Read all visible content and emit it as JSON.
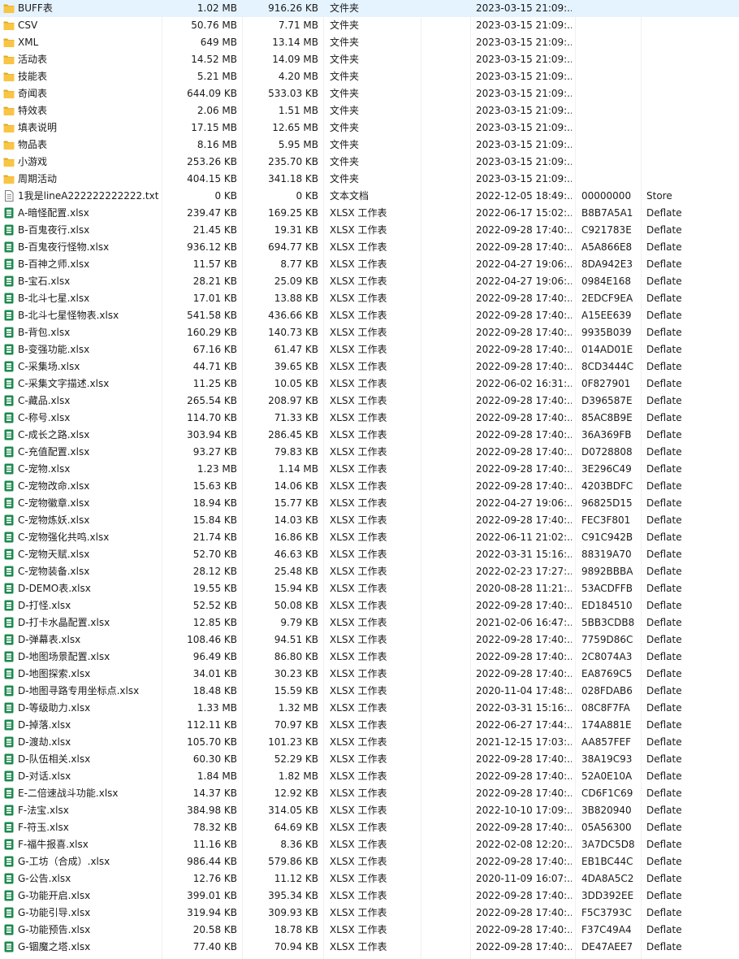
{
  "file_rows": [
    {
      "name": "BUFF表",
      "size": "1.02 MB",
      "packed": "916.26 KB",
      "type": "文件夹",
      "modified": "2023-03-15 21:09:...",
      "crc": "",
      "method": "",
      "icon": "folder-icon"
    },
    {
      "name": "CSV",
      "size": "50.76 MB",
      "packed": "7.71 MB",
      "type": "文件夹",
      "modified": "2023-03-15 21:09:...",
      "crc": "",
      "method": "",
      "icon": "folder-icon"
    },
    {
      "name": "XML",
      "size": "649 MB",
      "packed": "13.14 MB",
      "type": "文件夹",
      "modified": "2023-03-15 21:09:...",
      "crc": "",
      "method": "",
      "icon": "folder-icon"
    },
    {
      "name": "活动表",
      "size": "14.52 MB",
      "packed": "14.09 MB",
      "type": "文件夹",
      "modified": "2023-03-15 21:09:...",
      "crc": "",
      "method": "",
      "icon": "folder-icon"
    },
    {
      "name": "技能表",
      "size": "5.21 MB",
      "packed": "4.20 MB",
      "type": "文件夹",
      "modified": "2023-03-15 21:09:...",
      "crc": "",
      "method": "",
      "icon": "folder-icon"
    },
    {
      "name": "奇闻表",
      "size": "644.09 KB",
      "packed": "533.03 KB",
      "type": "文件夹",
      "modified": "2023-03-15 21:09:...",
      "crc": "",
      "method": "",
      "icon": "folder-icon"
    },
    {
      "name": "特效表",
      "size": "2.06 MB",
      "packed": "1.51 MB",
      "type": "文件夹",
      "modified": "2023-03-15 21:09:...",
      "crc": "",
      "method": "",
      "icon": "folder-icon"
    },
    {
      "name": "填表说明",
      "size": "17.15 MB",
      "packed": "12.65 MB",
      "type": "文件夹",
      "modified": "2023-03-15 21:09:...",
      "crc": "",
      "method": "",
      "icon": "folder-icon"
    },
    {
      "name": "物品表",
      "size": "8.16 MB",
      "packed": "5.95 MB",
      "type": "文件夹",
      "modified": "2023-03-15 21:09:...",
      "crc": "",
      "method": "",
      "icon": "folder-icon"
    },
    {
      "name": "小游戏",
      "size": "253.26 KB",
      "packed": "235.70 KB",
      "type": "文件夹",
      "modified": "2023-03-15 21:09:...",
      "crc": "",
      "method": "",
      "icon": "folder-icon"
    },
    {
      "name": "周期活动",
      "size": "404.15 KB",
      "packed": "341.18 KB",
      "type": "文件夹",
      "modified": "2023-03-15 21:09:...",
      "crc": "",
      "method": "",
      "icon": "folder-icon"
    },
    {
      "name": "1我是lineA222222222222.txt",
      "size": "0 KB",
      "packed": "0 KB",
      "type": "文本文档",
      "modified": "2022-12-05 18:49:...",
      "crc": "00000000",
      "method": "Store",
      "icon": "text-file-icon"
    },
    {
      "name": "A-暗怪配置.xlsx",
      "size": "239.47 KB",
      "packed": "169.25 KB",
      "type": "XLSX 工作表",
      "modified": "2022-06-17 15:02:...",
      "crc": "B8B7A5A1",
      "method": "Deflate",
      "icon": "xlsx-file-icon"
    },
    {
      "name": "B-百鬼夜行.xlsx",
      "size": "21.45 KB",
      "packed": "19.31 KB",
      "type": "XLSX 工作表",
      "modified": "2022-09-28 17:40:...",
      "crc": "C921783E",
      "method": "Deflate",
      "icon": "xlsx-file-icon"
    },
    {
      "name": "B-百鬼夜行怪物.xlsx",
      "size": "936.12 KB",
      "packed": "694.77 KB",
      "type": "XLSX 工作表",
      "modified": "2022-09-28 17:40:...",
      "crc": "A5A866E8",
      "method": "Deflate",
      "icon": "xlsx-file-icon"
    },
    {
      "name": "B-百神之师.xlsx",
      "size": "11.57 KB",
      "packed": "8.77 KB",
      "type": "XLSX 工作表",
      "modified": "2022-04-27 19:06:...",
      "crc": "8DA942E3",
      "method": "Deflate",
      "icon": "xlsx-file-icon"
    },
    {
      "name": "B-宝石.xlsx",
      "size": "28.21 KB",
      "packed": "25.09 KB",
      "type": "XLSX 工作表",
      "modified": "2022-04-27 19:06:...",
      "crc": "0984E168",
      "method": "Deflate",
      "icon": "xlsx-file-icon"
    },
    {
      "name": "B-北斗七星.xlsx",
      "size": "17.01 KB",
      "packed": "13.88 KB",
      "type": "XLSX 工作表",
      "modified": "2022-09-28 17:40:...",
      "crc": "2EDCF9EA",
      "method": "Deflate",
      "icon": "xlsx-file-icon"
    },
    {
      "name": "B-北斗七星怪物表.xlsx",
      "size": "541.58 KB",
      "packed": "436.66 KB",
      "type": "XLSX 工作表",
      "modified": "2022-09-28 17:40:...",
      "crc": "A15EE639",
      "method": "Deflate",
      "icon": "xlsx-file-icon"
    },
    {
      "name": "B-背包.xlsx",
      "size": "160.29 KB",
      "packed": "140.73 KB",
      "type": "XLSX 工作表",
      "modified": "2022-09-28 17:40:...",
      "crc": "9935B039",
      "method": "Deflate",
      "icon": "xlsx-file-icon"
    },
    {
      "name": "B-变强功能.xlsx",
      "size": "67.16 KB",
      "packed": "61.47 KB",
      "type": "XLSX 工作表",
      "modified": "2022-09-28 17:40:...",
      "crc": "014AD01E",
      "method": "Deflate",
      "icon": "xlsx-file-icon"
    },
    {
      "name": "C-采集场.xlsx",
      "size": "44.71 KB",
      "packed": "39.65 KB",
      "type": "XLSX 工作表",
      "modified": "2022-09-28 17:40:...",
      "crc": "8CD3444C",
      "method": "Deflate",
      "icon": "xlsx-file-icon"
    },
    {
      "name": "C-采集文字描述.xlsx",
      "size": "11.25 KB",
      "packed": "10.05 KB",
      "type": "XLSX 工作表",
      "modified": "2022-06-02 16:31:...",
      "crc": "0F827901",
      "method": "Deflate",
      "icon": "xlsx-file-icon"
    },
    {
      "name": "C-藏品.xlsx",
      "size": "265.54 KB",
      "packed": "208.97 KB",
      "type": "XLSX 工作表",
      "modified": "2022-09-28 17:40:...",
      "crc": "D396587E",
      "method": "Deflate",
      "icon": "xlsx-file-icon"
    },
    {
      "name": "C-称号.xlsx",
      "size": "114.70 KB",
      "packed": "71.33 KB",
      "type": "XLSX 工作表",
      "modified": "2022-09-28 17:40:...",
      "crc": "85AC8B9E",
      "method": "Deflate",
      "icon": "xlsx-file-icon"
    },
    {
      "name": "C-成长之路.xlsx",
      "size": "303.94 KB",
      "packed": "286.45 KB",
      "type": "XLSX 工作表",
      "modified": "2022-09-28 17:40:...",
      "crc": "36A369FB",
      "method": "Deflate",
      "icon": "xlsx-file-icon"
    },
    {
      "name": "C-充值配置.xlsx",
      "size": "93.27 KB",
      "packed": "79.83 KB",
      "type": "XLSX 工作表",
      "modified": "2022-09-28 17:40:...",
      "crc": "D0728808",
      "method": "Deflate",
      "icon": "xlsx-file-icon"
    },
    {
      "name": "C-宠物.xlsx",
      "size": "1.23 MB",
      "packed": "1.14 MB",
      "type": "XLSX 工作表",
      "modified": "2022-09-28 17:40:...",
      "crc": "3E296C49",
      "method": "Deflate",
      "icon": "xlsx-file-icon"
    },
    {
      "name": "C-宠物改命.xlsx",
      "size": "15.63 KB",
      "packed": "14.06 KB",
      "type": "XLSX 工作表",
      "modified": "2022-09-28 17:40:...",
      "crc": "4203BDFC",
      "method": "Deflate",
      "icon": "xlsx-file-icon"
    },
    {
      "name": "C-宠物徽章.xlsx",
      "size": "18.94 KB",
      "packed": "15.77 KB",
      "type": "XLSX 工作表",
      "modified": "2022-04-27 19:06:...",
      "crc": "96825D15",
      "method": "Deflate",
      "icon": "xlsx-file-icon"
    },
    {
      "name": "C-宠物炼妖.xlsx",
      "size": "15.84 KB",
      "packed": "14.03 KB",
      "type": "XLSX 工作表",
      "modified": "2022-09-28 17:40:...",
      "crc": "FEC3F801",
      "method": "Deflate",
      "icon": "xlsx-file-icon"
    },
    {
      "name": "C-宠物强化共鸣.xlsx",
      "size": "21.74 KB",
      "packed": "16.86 KB",
      "type": "XLSX 工作表",
      "modified": "2022-06-11 21:02:...",
      "crc": "C91C942B",
      "method": "Deflate",
      "icon": "xlsx-file-icon"
    },
    {
      "name": "C-宠物天赋.xlsx",
      "size": "52.70 KB",
      "packed": "46.63 KB",
      "type": "XLSX 工作表",
      "modified": "2022-03-31 15:16:...",
      "crc": "88319A70",
      "method": "Deflate",
      "icon": "xlsx-file-icon"
    },
    {
      "name": "C-宠物装备.xlsx",
      "size": "28.12 KB",
      "packed": "25.48 KB",
      "type": "XLSX 工作表",
      "modified": "2022-02-23 17:27:...",
      "crc": "9892BBBA",
      "method": "Deflate",
      "icon": "xlsx-file-icon"
    },
    {
      "name": "D-DEMO表.xlsx",
      "size": "19.55 KB",
      "packed": "15.94 KB",
      "type": "XLSX 工作表",
      "modified": "2020-08-28 11:21:...",
      "crc": "53ACDFFB",
      "method": "Deflate",
      "icon": "xlsx-file-icon"
    },
    {
      "name": "D-打怪.xlsx",
      "size": "52.52 KB",
      "packed": "50.08 KB",
      "type": "XLSX 工作表",
      "modified": "2022-09-28 17:40:...",
      "crc": "ED184510",
      "method": "Deflate",
      "icon": "xlsx-file-icon"
    },
    {
      "name": "D-打卡水晶配置.xlsx",
      "size": "12.85 KB",
      "packed": "9.79 KB",
      "type": "XLSX 工作表",
      "modified": "2021-02-06 16:47:...",
      "crc": "5BB3CDB8",
      "method": "Deflate",
      "icon": "xlsx-file-icon"
    },
    {
      "name": "D-弹幕表.xlsx",
      "size": "108.46 KB",
      "packed": "94.51 KB",
      "type": "XLSX 工作表",
      "modified": "2022-09-28 17:40:...",
      "crc": "7759D86C",
      "method": "Deflate",
      "icon": "xlsx-file-icon"
    },
    {
      "name": "D-地图场景配置.xlsx",
      "size": "96.49 KB",
      "packed": "86.80 KB",
      "type": "XLSX 工作表",
      "modified": "2022-09-28 17:40:...",
      "crc": "2C8074A3",
      "method": "Deflate",
      "icon": "xlsx-file-icon"
    },
    {
      "name": "D-地图探索.xlsx",
      "size": "34.01 KB",
      "packed": "30.23 KB",
      "type": "XLSX 工作表",
      "modified": "2022-09-28 17:40:...",
      "crc": "EA8769C5",
      "method": "Deflate",
      "icon": "xlsx-file-icon"
    },
    {
      "name": "D-地图寻路专用坐标点.xlsx",
      "size": "18.48 KB",
      "packed": "15.59 KB",
      "type": "XLSX 工作表",
      "modified": "2020-11-04 17:48:...",
      "crc": "028FDAB6",
      "method": "Deflate",
      "icon": "xlsx-file-icon"
    },
    {
      "name": "D-等级助力.xlsx",
      "size": "1.33 MB",
      "packed": "1.32 MB",
      "type": "XLSX 工作表",
      "modified": "2022-03-31 15:16:...",
      "crc": "08C8F7FA",
      "method": "Deflate",
      "icon": "xlsx-file-icon"
    },
    {
      "name": "D-掉落.xlsx",
      "size": "112.11 KB",
      "packed": "70.97 KB",
      "type": "XLSX 工作表",
      "modified": "2022-06-27 17:44:...",
      "crc": "174A881E",
      "method": "Deflate",
      "icon": "xlsx-file-icon"
    },
    {
      "name": "D-渡劫.xlsx",
      "size": "105.70 KB",
      "packed": "101.23 KB",
      "type": "XLSX 工作表",
      "modified": "2021-12-15 17:03:...",
      "crc": "AA857FEF",
      "method": "Deflate",
      "icon": "xlsx-file-icon"
    },
    {
      "name": "D-队伍相关.xlsx",
      "size": "60.30 KB",
      "packed": "52.29 KB",
      "type": "XLSX 工作表",
      "modified": "2022-09-28 17:40:...",
      "crc": "38A19C93",
      "method": "Deflate",
      "icon": "xlsx-file-icon"
    },
    {
      "name": "D-对话.xlsx",
      "size": "1.84 MB",
      "packed": "1.82 MB",
      "type": "XLSX 工作表",
      "modified": "2022-09-28 17:40:...",
      "crc": "52A0E10A",
      "method": "Deflate",
      "icon": "xlsx-file-icon"
    },
    {
      "name": "E-二倍速战斗功能.xlsx",
      "size": "14.37 KB",
      "packed": "12.92 KB",
      "type": "XLSX 工作表",
      "modified": "2022-09-28 17:40:...",
      "crc": "CD6F1C69",
      "method": "Deflate",
      "icon": "xlsx-file-icon"
    },
    {
      "name": "F-法宝.xlsx",
      "size": "384.98 KB",
      "packed": "314.05 KB",
      "type": "XLSX 工作表",
      "modified": "2022-10-10 17:09:...",
      "crc": "3B820940",
      "method": "Deflate",
      "icon": "xlsx-file-icon"
    },
    {
      "name": "F-符玉.xlsx",
      "size": "78.32 KB",
      "packed": "64.69 KB",
      "type": "XLSX 工作表",
      "modified": "2022-09-28 17:40:...",
      "crc": "05A56300",
      "method": "Deflate",
      "icon": "xlsx-file-icon"
    },
    {
      "name": "F-福牛报喜.xlsx",
      "size": "11.16 KB",
      "packed": "8.36 KB",
      "type": "XLSX 工作表",
      "modified": "2022-02-08 12:20:...",
      "crc": "3A7DC5D8",
      "method": "Deflate",
      "icon": "xlsx-file-icon"
    },
    {
      "name": "G-工坊（合成）.xlsx",
      "size": "986.44 KB",
      "packed": "579.86 KB",
      "type": "XLSX 工作表",
      "modified": "2022-09-28 17:40:...",
      "crc": "EB1BC44C",
      "method": "Deflate",
      "icon": "xlsx-file-icon"
    },
    {
      "name": "G-公告.xlsx",
      "size": "12.76 KB",
      "packed": "11.12 KB",
      "type": "XLSX 工作表",
      "modified": "2020-11-09 16:07:...",
      "crc": "4DA8A5C2",
      "method": "Deflate",
      "icon": "xlsx-file-icon"
    },
    {
      "name": "G-功能开启.xlsx",
      "size": "399.01 KB",
      "packed": "395.34 KB",
      "type": "XLSX 工作表",
      "modified": "2022-09-28 17:40:...",
      "crc": "3DD392EE",
      "method": "Deflate",
      "icon": "xlsx-file-icon"
    },
    {
      "name": "G-功能引导.xlsx",
      "size": "319.94 KB",
      "packed": "309.93 KB",
      "type": "XLSX 工作表",
      "modified": "2022-09-28 17:40:...",
      "crc": "F5C3793C",
      "method": "Deflate",
      "icon": "xlsx-file-icon"
    },
    {
      "name": "G-功能预告.xlsx",
      "size": "20.58 KB",
      "packed": "18.78 KB",
      "type": "XLSX 工作表",
      "modified": "2022-09-28 17:40:...",
      "crc": "F37C49A4",
      "method": "Deflate",
      "icon": "xlsx-file-icon"
    },
    {
      "name": "G-锢魔之塔.xlsx",
      "size": "77.40 KB",
      "packed": "70.94 KB",
      "type": "XLSX 工作表",
      "modified": "2022-09-28 17:40:...",
      "crc": "DE47AEE7",
      "method": "Deflate",
      "icon": "xlsx-file-icon"
    }
  ],
  "colors": {
    "folder": "#F8C544",
    "xlsx": "#1D8B4E",
    "text_file": "#7A7A7A"
  }
}
